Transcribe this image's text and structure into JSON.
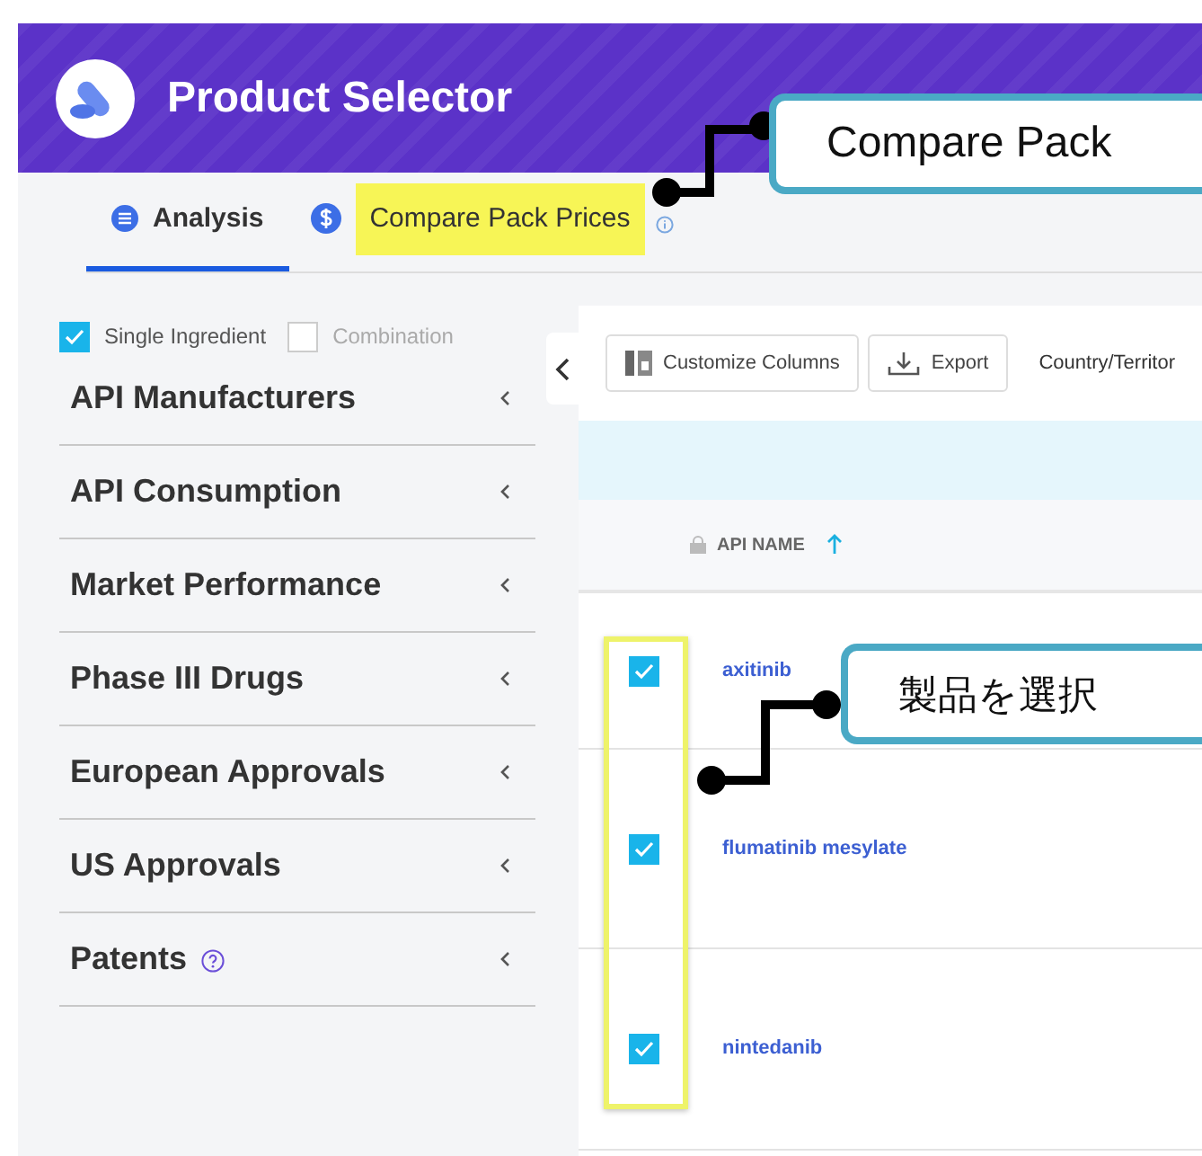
{
  "app": {
    "title": "Product Selector"
  },
  "tabs": [
    {
      "label": "Analysis",
      "selected": true,
      "highlighted": false,
      "kind": "list"
    },
    {
      "label": "Compare Pack Prices",
      "selected": false,
      "highlighted": true,
      "kind": "price"
    }
  ],
  "filters": [
    {
      "label": "Single Ingredient",
      "checked": true
    },
    {
      "label": "Combination",
      "checked": false
    }
  ],
  "sections": [
    {
      "label": "API Manufacturers",
      "help": false
    },
    {
      "label": "API Consumption",
      "help": false
    },
    {
      "label": "Market Performance",
      "help": false
    },
    {
      "label": "Phase III Drugs",
      "help": false
    },
    {
      "label": "European Approvals",
      "help": false
    },
    {
      "label": "US Approvals",
      "help": false
    },
    {
      "label": "Patents",
      "help": true
    }
  ],
  "toolbar": {
    "buttons": [
      {
        "label": "Customize Columns",
        "kind": "columns"
      },
      {
        "label": "Export",
        "kind": "export"
      }
    ],
    "country_label": "Country/Territor"
  },
  "table": {
    "columns": [
      {
        "label": "API NAME",
        "locked": true,
        "sort_ascending": true
      }
    ],
    "rows": [
      {
        "api_name": "axitinib",
        "checked": true
      },
      {
        "api_name": "flumatinib mesylate",
        "checked": true
      },
      {
        "api_name": "nintedanib",
        "checked": true
      }
    ]
  },
  "annotations": [
    {
      "text": "Compare Pack"
    },
    {
      "text": "製品を選択"
    }
  ]
}
